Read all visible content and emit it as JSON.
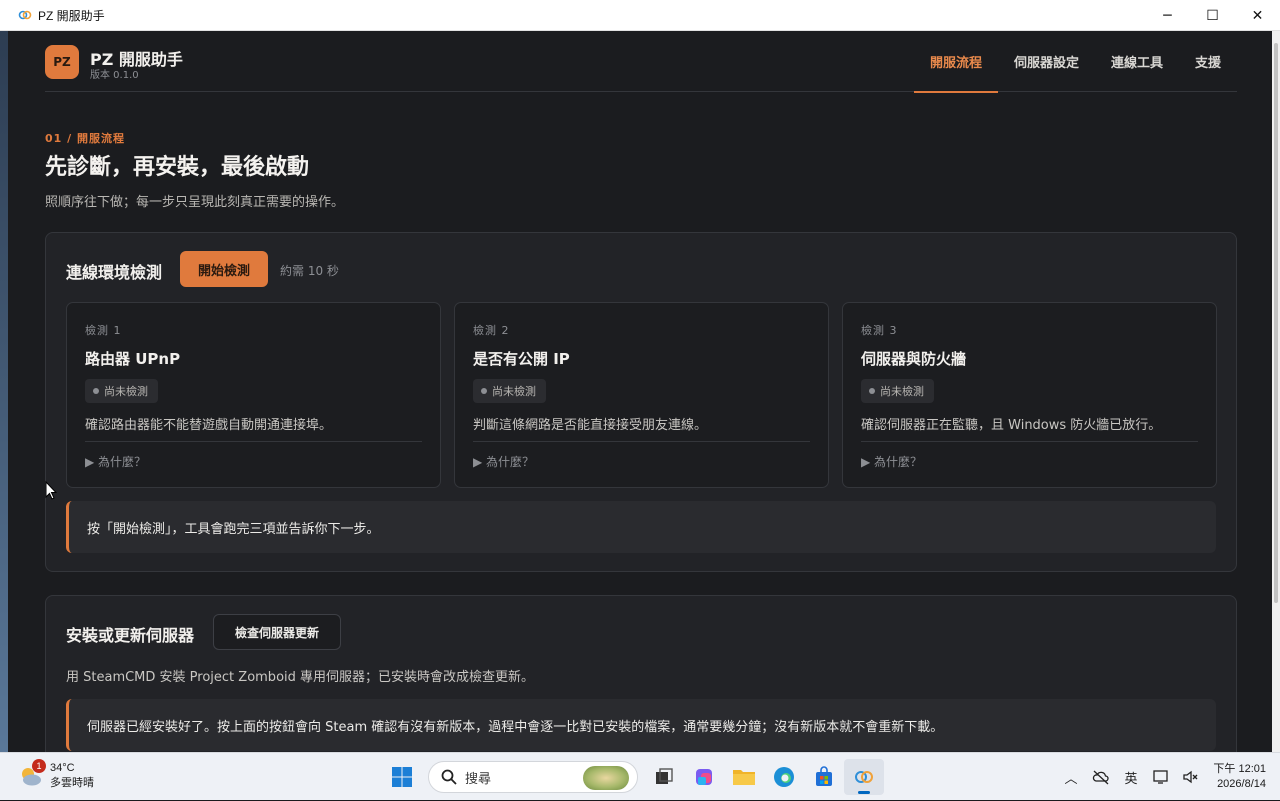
{
  "window": {
    "title": "PZ 開服助手",
    "minimize_glyph": "─",
    "maximize_glyph": "☐",
    "close_glyph": "✕"
  },
  "header": {
    "logo_text": "PZ",
    "app_name": "PZ 開服助手",
    "version": "版本 0.1.0",
    "nav": [
      {
        "label": "開服流程",
        "active": true
      },
      {
        "label": "伺服器設定",
        "active": false
      },
      {
        "label": "連線工具",
        "active": false
      },
      {
        "label": "支援",
        "active": false
      }
    ]
  },
  "page": {
    "breadcrumb": "01 / 開服流程",
    "title": "先診斷，再安裝，最後啟動",
    "subtitle": "照順序往下做；每一步只呈現此刻真正需要的操作。"
  },
  "diagnostics": {
    "title": "連線環境檢測",
    "start_button": "開始檢測",
    "duration_hint": "約需 10 秒",
    "checks": [
      {
        "step": "檢測 1",
        "title": "路由器 UPnP",
        "status": "尚未檢測",
        "description": "確認路由器能不能替遊戲自動開通連接埠。",
        "why": "▶ 為什麼？"
      },
      {
        "step": "檢測 2",
        "title": "是否有公開 IP",
        "status": "尚未檢測",
        "description": "判斷這條網路是否能直接接受朋友連線。",
        "why": "▶ 為什麼？"
      },
      {
        "step": "檢測 3",
        "title": "伺服器與防火牆",
        "status": "尚未檢測",
        "description": "確認伺服器正在監聽，且 Windows 防火牆已放行。",
        "why": "▶ 為什麼？"
      }
    ],
    "notice": "按「開始檢測」，工具會跑完三項並告訴你下一步。"
  },
  "install": {
    "title": "安裝或更新伺服器",
    "check_button": "檢查伺服器更新",
    "description": "用 SteamCMD 安裝 Project Zomboid 專用伺服器；已安裝時會改成檢查更新。",
    "notice": "伺服器已經安裝好了。按上面的按鈕會向 Steam 確認有沒有新版本，過程中會逐一比對已安裝的檔案，通常要幾分鐘；沒有新版本就不會重新下載。"
  },
  "taskbar": {
    "weather_temp": "34°C",
    "weather_desc": "多雲時晴",
    "weather_badge": "1",
    "search_placeholder": "搜尋",
    "tray_lang": "英",
    "clock_time": "下午 12:01",
    "clock_date": "2026/8/14",
    "accent_color": "#0067c0"
  },
  "colors": {
    "accent": "#e07a3d",
    "background": "#1b1c1f",
    "panel": "#222327"
  }
}
